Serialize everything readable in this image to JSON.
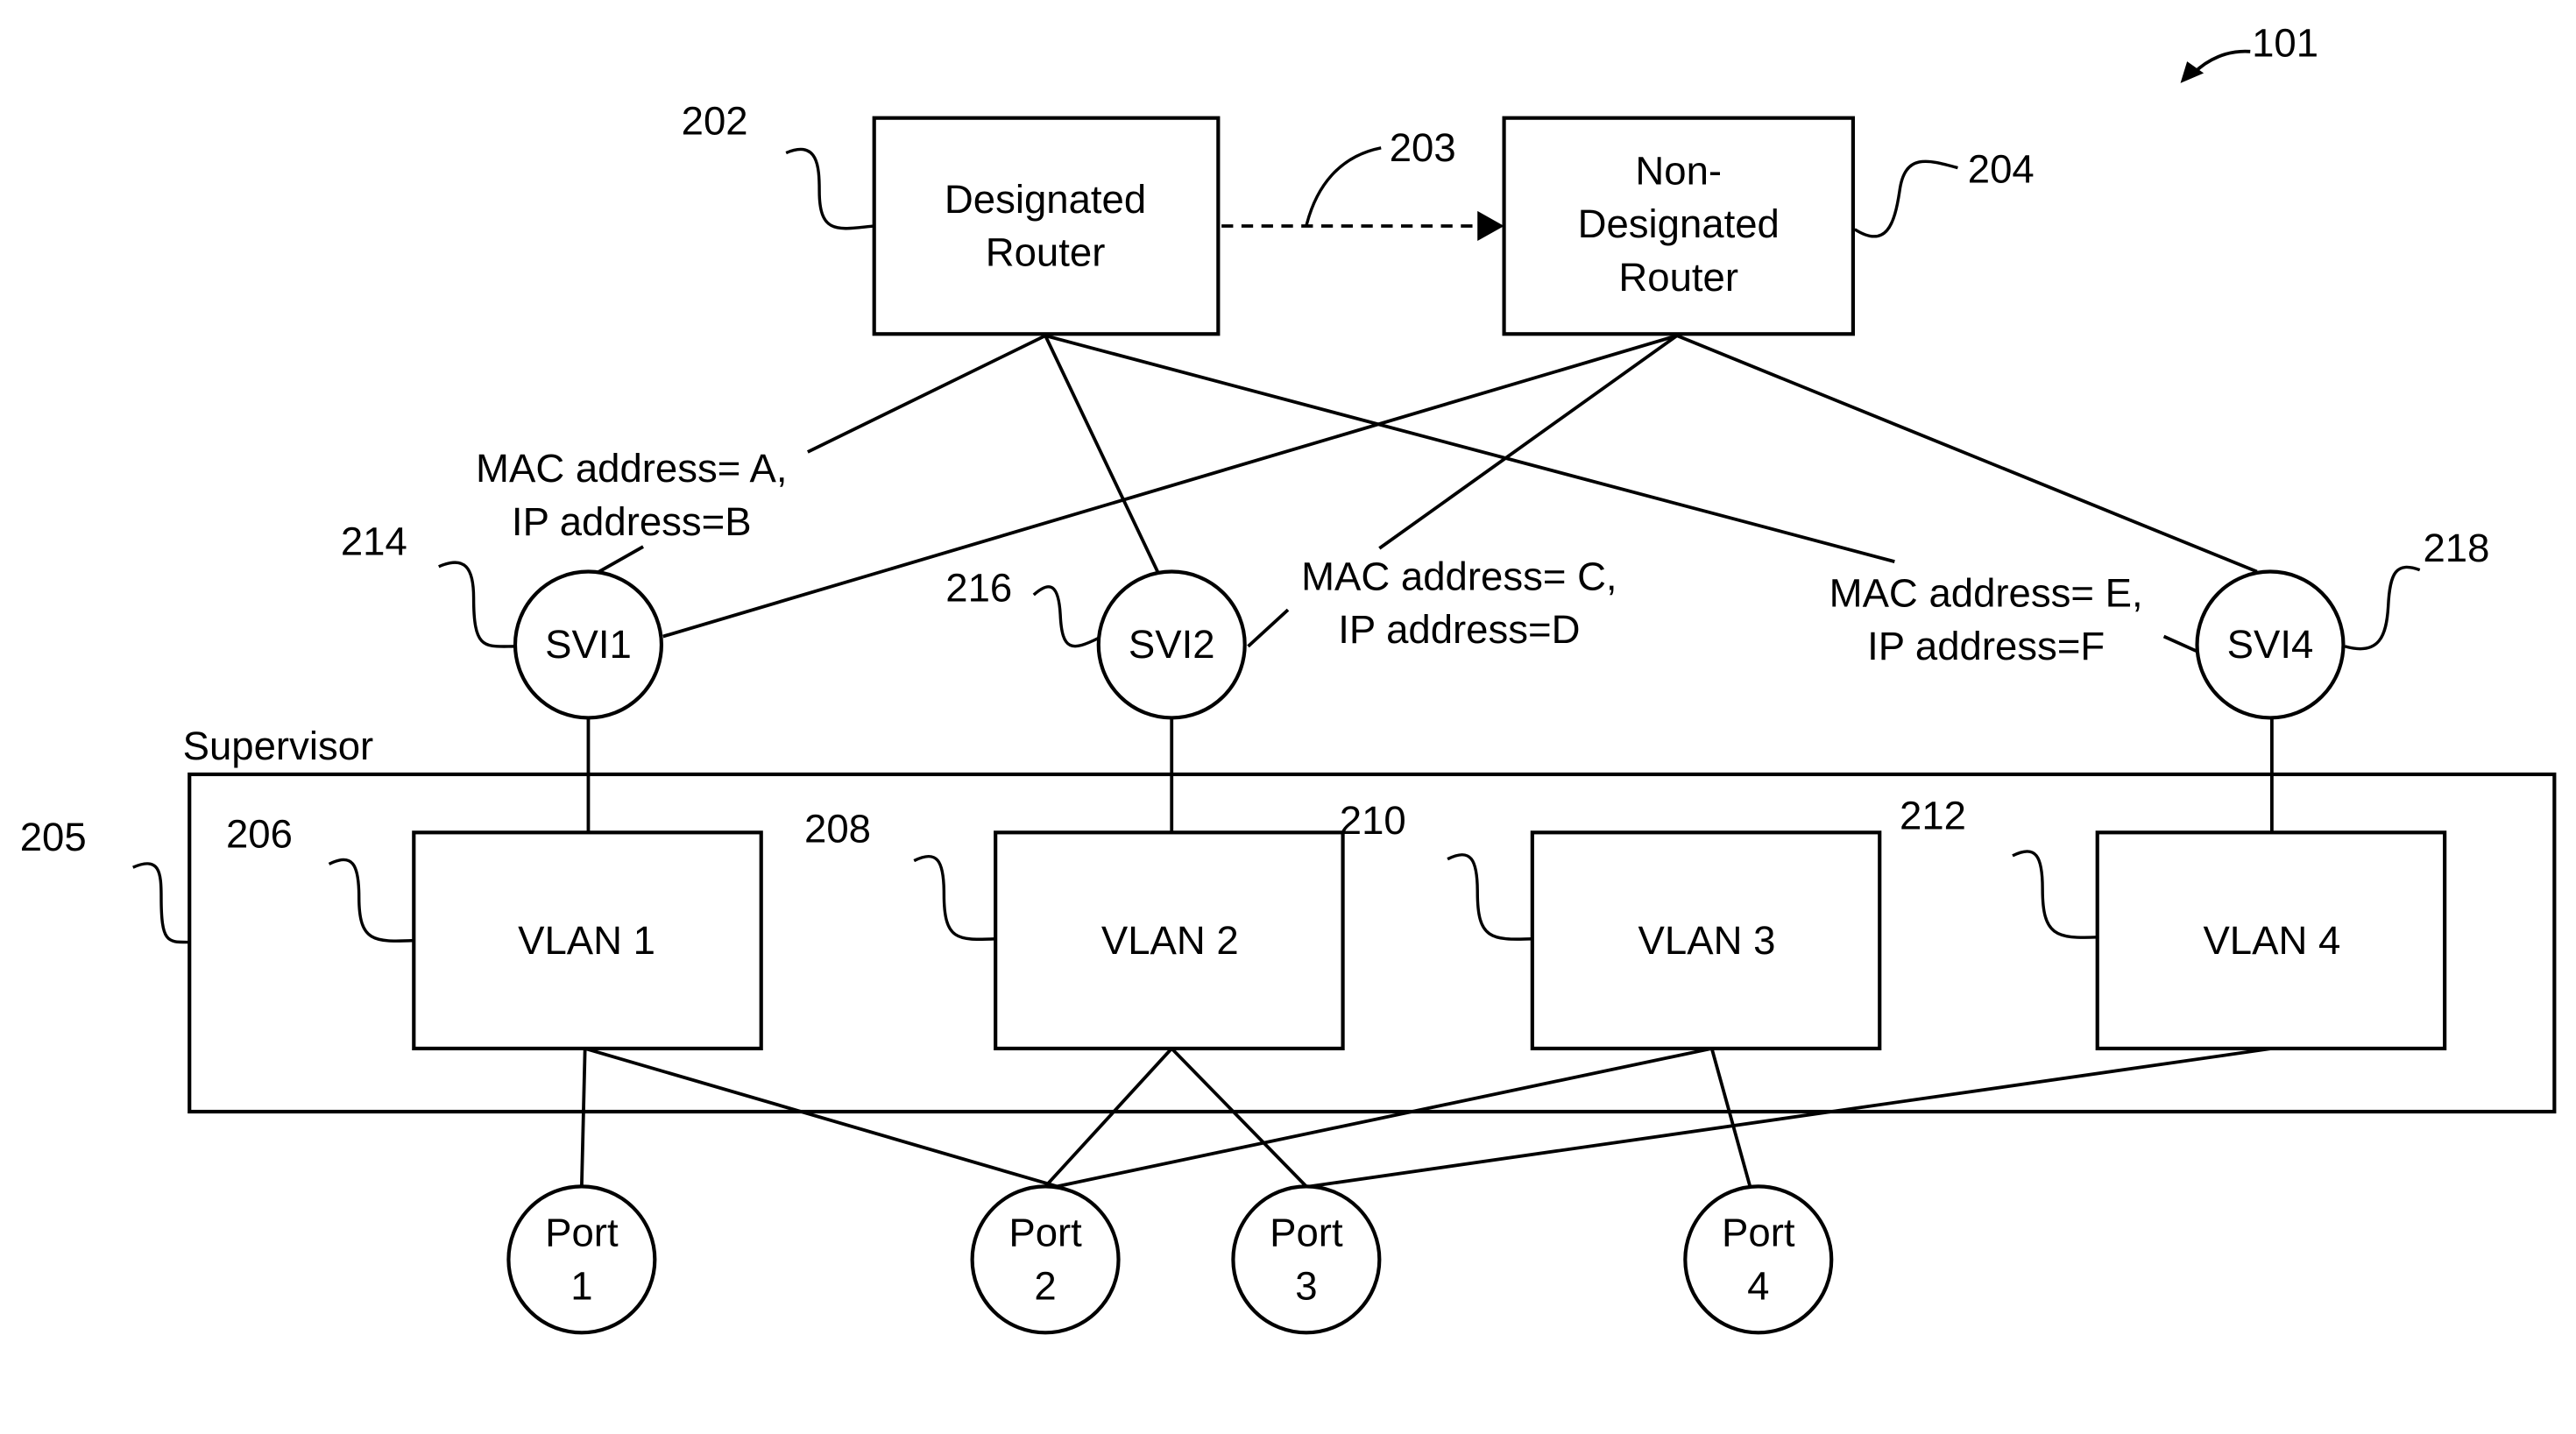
{
  "figure": {
    "reference": "101"
  },
  "routers": {
    "designated": {
      "ref": "202",
      "line1": "Designated",
      "line2": "Router"
    },
    "non_designated": {
      "ref": "204",
      "line1": "Non-",
      "line2": "Designated",
      "line3": "Router"
    },
    "link_ref": "203"
  },
  "svis": [
    {
      "ref": "214",
      "label": "SVI1"
    },
    {
      "ref": "216",
      "label": "SVI2"
    },
    {
      "ref": "218",
      "label": "SVI4"
    }
  ],
  "annotations": [
    {
      "line1": "MAC address= A,",
      "line2": "IP address=B"
    },
    {
      "line1": "MAC address= C,",
      "line2": "IP address=D"
    },
    {
      "line1": "MAC address= E,",
      "line2": "IP address=F"
    }
  ],
  "supervisor": {
    "ref": "205",
    "label": "Supervisor"
  },
  "vlans": [
    {
      "ref": "206",
      "label": "VLAN 1"
    },
    {
      "ref": "208",
      "label": "VLAN 2"
    },
    {
      "ref": "210",
      "label": "VLAN 3"
    },
    {
      "ref": "212",
      "label": "VLAN 4"
    }
  ],
  "ports": [
    {
      "line1": "Port",
      "line2": "1"
    },
    {
      "line1": "Port",
      "line2": "2"
    },
    {
      "line1": "Port",
      "line2": "3"
    },
    {
      "line1": "Port",
      "line2": "4"
    }
  ]
}
